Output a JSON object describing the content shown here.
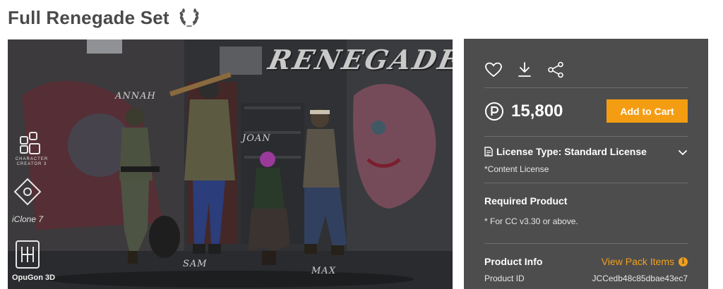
{
  "header": {
    "title": "Full Renegade Set",
    "badge_icon": "laurel-icon"
  },
  "image": {
    "logo_text": "RENEGADES",
    "characters": [
      "ANNAH",
      "SAM",
      "JOAN",
      "MAX"
    ],
    "badges": {
      "cc_label": "CHARACTER CREATOR 3",
      "iclone_label": "iClone 7",
      "opugon_label": "OpuGon 3D"
    }
  },
  "panel": {
    "actions": [
      "heart-icon",
      "download-icon",
      "share-icon"
    ],
    "price": "15,800",
    "currency_icon": "point-icon",
    "add_to_cart": "Add to Cart",
    "license_type": "License Type: Standard License",
    "license_note": "*Content License",
    "required_title": "Required Product",
    "required_note": "* For CC v3.30 or above.",
    "product_info_label": "Product Info",
    "view_pack_items": "View Pack Items",
    "product_id_label": "Product ID",
    "product_id_value": "JCCedb48c85dbae43ec7",
    "accent_color": "#f59d12",
    "panel_color": "#4d4d4d"
  }
}
